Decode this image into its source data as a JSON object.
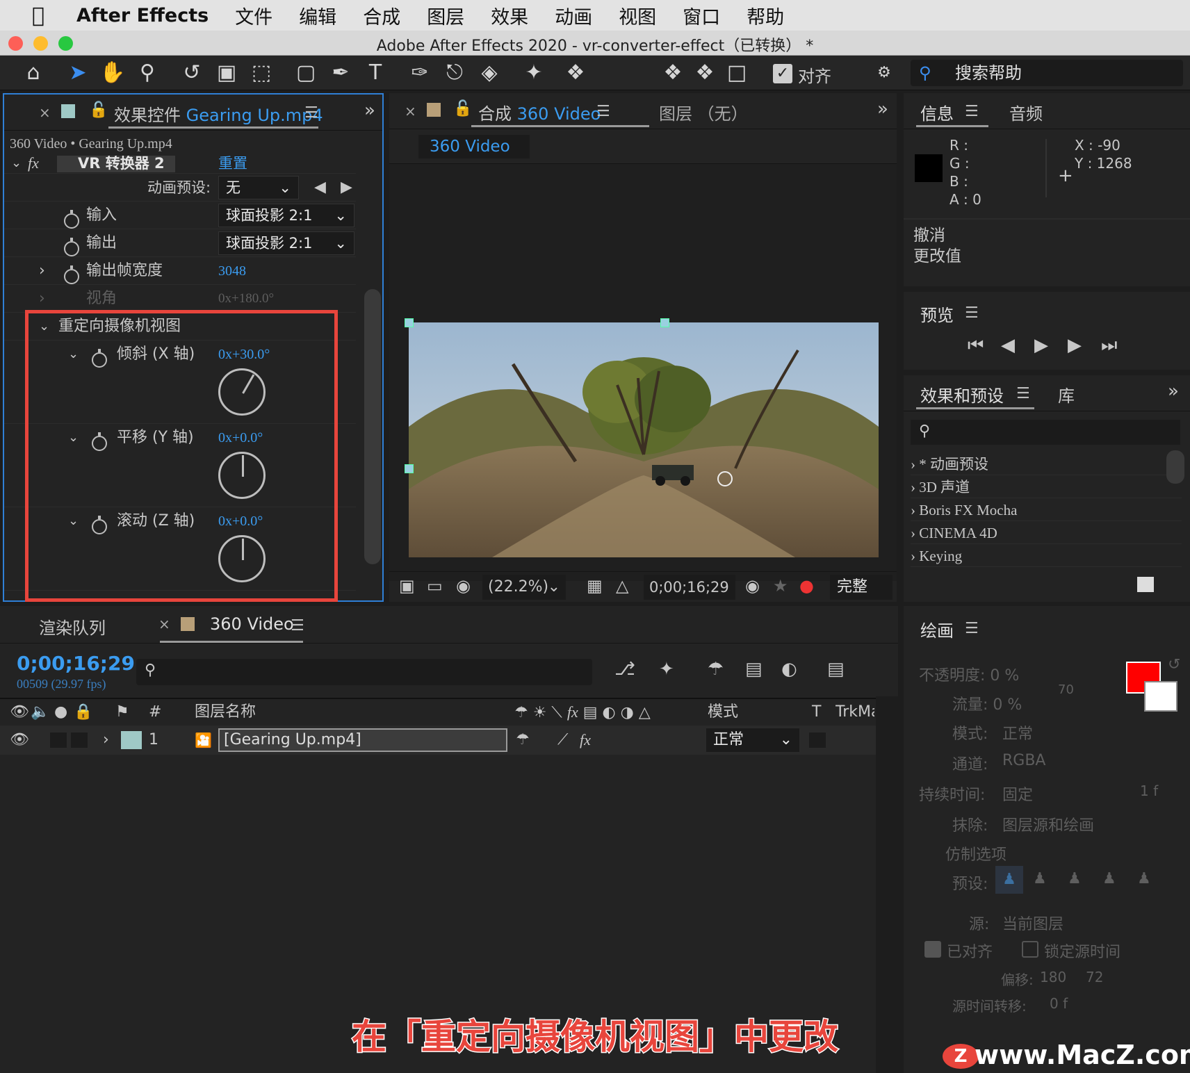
{
  "menubar": {
    "app_name": "After Effects",
    "items": [
      "文件",
      "编辑",
      "合成",
      "图层",
      "效果",
      "动画",
      "视图",
      "窗口",
      "帮助"
    ]
  },
  "window": {
    "title": "Adobe After Effects 2020 - vr-converter-effect（已转换） *"
  },
  "toolbar": {
    "align_label": "对齐",
    "search_help_label": "搜索帮助"
  },
  "effect_controls": {
    "tab_prefix": "效果控件",
    "tab_file": "Gearing Up.mp4",
    "breadcrumb": "360 Video • Gearing Up.mp4",
    "effect_name": "VR 转换器 2",
    "reset_label": "重置",
    "preset_label": "动画预设:",
    "preset_value": "无",
    "input_label": "输入",
    "input_value": "球面投影 2:1",
    "output_label": "输出",
    "output_value": "球面投影 2:1",
    "frame_width_label": "输出帧宽度",
    "frame_width_value": "3048",
    "fov_label": "视角",
    "fov_value": "0x+180.0°",
    "reorient_group_label": "重定向摄像机视图",
    "tilt_label": "倾斜 (X 轴)",
    "tilt_value": "0x+30.0°",
    "pan_label": "平移 (Y 轴)",
    "pan_value": "0x+0.0°",
    "roll_label": "滚动 (Z 轴)",
    "roll_value": "0x+0.0°"
  },
  "composition": {
    "tab_prefix": "合成",
    "tab_name": "360 Video",
    "layer_tab": "图层 （无）",
    "flow_tab": "360 Video",
    "zoom": "(22.2%)",
    "timecode": "0;00;16;29",
    "resolution": "完整"
  },
  "info_panel": {
    "tab_info": "信息",
    "tab_audio": "音频",
    "r_label": "R :",
    "g_label": "G :",
    "b_label": "B :",
    "a_label": "A :",
    "a_value": "0",
    "x_label": "X : -90",
    "y_label": "Y : 1268",
    "undo_line1": "撤消",
    "undo_line2": "更改值"
  },
  "preview_panel": {
    "title": "预览"
  },
  "effects_presets": {
    "tab_effects": "效果和预设",
    "tab_library": "库",
    "items": [
      "* 动画预设",
      "3D 声道",
      "Boris FX Mocha",
      "CINEMA 4D",
      "Keying"
    ]
  },
  "timeline": {
    "tab_render": "渲染队列",
    "tab_comp": "360 Video",
    "timecode": "0;00;16;29",
    "frames": "00509 (29.97 fps)",
    "col_num": "#",
    "col_layer_name": "图层名称",
    "col_mode": "模式",
    "col_t": "T",
    "col_trkmat": "TrkMat",
    "layer_index": "1",
    "layer_name": "[Gearing Up.mp4]",
    "layer_mode": "正常"
  },
  "paint_panel": {
    "title": "绘画",
    "opacity": "不透明度: 0 %",
    "flow": "流量: 0 %",
    "brush_size": "70",
    "mode_label": "模式:",
    "mode_value": "正常",
    "channel_label": "通道:",
    "channel_value": "RGBA",
    "duration_label": "持续时间:",
    "duration_value": "固定",
    "duration_frames": "1 f",
    "erase_label": "抹除:",
    "erase_value": "图层源和绘画",
    "clone_options": "仿制选项",
    "preset_label": "预设:",
    "source_label": "源:",
    "source_value": "当前图层",
    "aligned_label": "已对齐",
    "lock_time_label": "锁定源时间",
    "offset_label": "偏移:",
    "offset_x": "180",
    "offset_y": "72",
    "time_shift_label": "源时间转移:",
    "time_shift_value": "0 f",
    "foreground_color": "#ff0000",
    "background_color": "#ffffff"
  },
  "overlay": {
    "caption": "在「重定向摄像机视图」中更改",
    "watermark": "www.MacZ.com",
    "highlight_color": "#e8453c"
  }
}
